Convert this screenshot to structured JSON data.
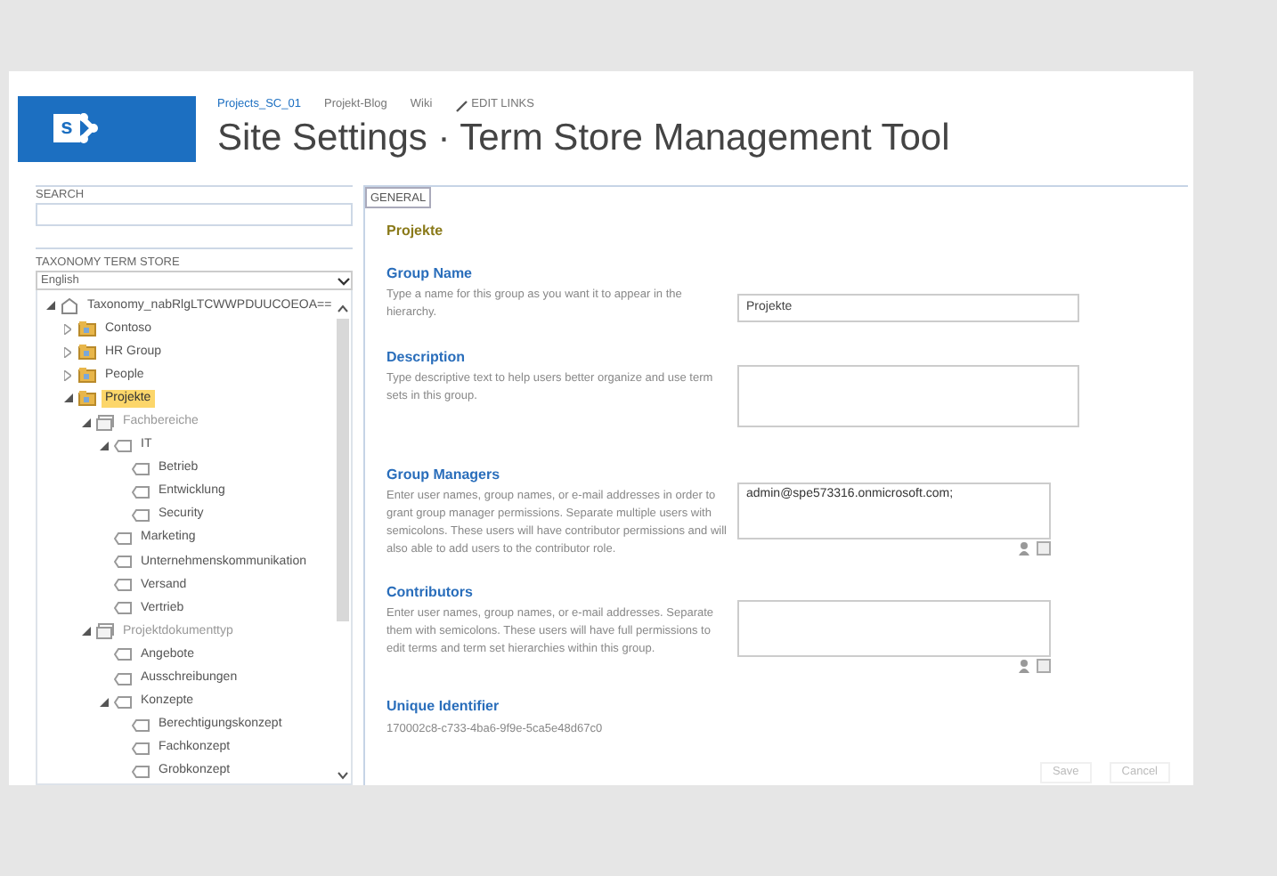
{
  "logo_letter": "s",
  "nav_links": [
    {
      "label": "Projects_SC_01",
      "selected": true
    },
    {
      "label": "Projekt-Blog",
      "selected": false
    },
    {
      "label": "Wiki",
      "selected": false
    },
    {
      "label": "EDIT LINKS",
      "selected": false,
      "kind": "edit"
    }
  ],
  "page_title": "Site Settings · Term Store Management Tool",
  "left_panel": {
    "search_label": "SEARCH",
    "store_label": "TAXONOMY TERM STORE",
    "language": "English",
    "tree": [
      {
        "label": "Taxonomy_nabRlgLTCWWPDUUCOEOA==",
        "kind": "store",
        "expanded": true,
        "selected": false,
        "children": [
          {
            "label": "Contoso",
            "kind": "group",
            "expanded": false,
            "selected": false
          },
          {
            "label": "HR Group",
            "kind": "group",
            "expanded": false,
            "selected": false
          },
          {
            "label": "People",
            "kind": "group",
            "expanded": false,
            "selected": false
          },
          {
            "label": "Projekte",
            "kind": "group",
            "expanded": true,
            "selected": true,
            "children": [
              {
                "label": "Fachbereiche",
                "kind": "termset",
                "expanded": true,
                "selected": false,
                "children": [
                  {
                    "label": "IT",
                    "kind": "term",
                    "expanded": true,
                    "selected": false,
                    "children": [
                      {
                        "label": "Betrieb",
                        "kind": "term",
                        "selected": false
                      },
                      {
                        "label": "Entwicklung",
                        "kind": "term",
                        "selected": false
                      },
                      {
                        "label": "Security",
                        "kind": "term",
                        "selected": false
                      }
                    ]
                  },
                  {
                    "label": "Marketing",
                    "kind": "term",
                    "selected": false
                  },
                  {
                    "label": "Unternehmenskommunikation",
                    "kind": "term",
                    "selected": false
                  },
                  {
                    "label": "Versand",
                    "kind": "term",
                    "selected": false
                  },
                  {
                    "label": "Vertrieb",
                    "kind": "term",
                    "selected": false
                  }
                ]
              },
              {
                "label": "Projektdokumenttyp",
                "kind": "termset",
                "expanded": true,
                "selected": false,
                "children": [
                  {
                    "label": "Angebote",
                    "kind": "term",
                    "selected": false
                  },
                  {
                    "label": "Ausschreibungen",
                    "kind": "term",
                    "selected": false
                  },
                  {
                    "label": "Konzepte",
                    "kind": "term",
                    "expanded": true,
                    "selected": false,
                    "children": [
                      {
                        "label": "Berechtigungskonzept",
                        "kind": "term",
                        "selected": false
                      },
                      {
                        "label": "Fachkonzept",
                        "kind": "term",
                        "selected": false
                      },
                      {
                        "label": "Grobkonzept",
                        "kind": "term",
                        "selected": false
                      }
                    ]
                  }
                ]
              }
            ]
          }
        ]
      }
    ]
  },
  "tabs": [
    {
      "label": "GENERAL",
      "selected": true
    }
  ],
  "group_title": "Projekte",
  "sections": [
    {
      "title": "Group Name",
      "help": "Type a name for this group as you want it to appear in the hierarchy.",
      "kind": "input",
      "value": "Projekte"
    },
    {
      "title": "Description",
      "help": "Type descriptive text to help users better organize and use term sets in this group.",
      "kind": "textarea"
    },
    {
      "title": "Group Managers",
      "help": "Enter user names, group names, or e-mail addresses in order to grant group manager permissions. Separate multiple users with semicolons. These users will have contributor permissions and will also able to add users to the contributor role.",
      "kind": "people",
      "value": "admin@spe573316.onmicrosoft.com;"
    },
    {
      "title": "Contributors",
      "help": "Enter user names, group names, or e-mail addresses. Separate them with semicolons. These users will have full permissions to edit terms and term set hierarchies within this group.",
      "kind": "people"
    },
    {
      "title": "Unique Identifier",
      "kind": "text",
      "value": "170002c8-c733-4ba6-9f9e-5ca5e48d67c0"
    }
  ],
  "buttons": [
    "Save",
    "Cancel"
  ]
}
